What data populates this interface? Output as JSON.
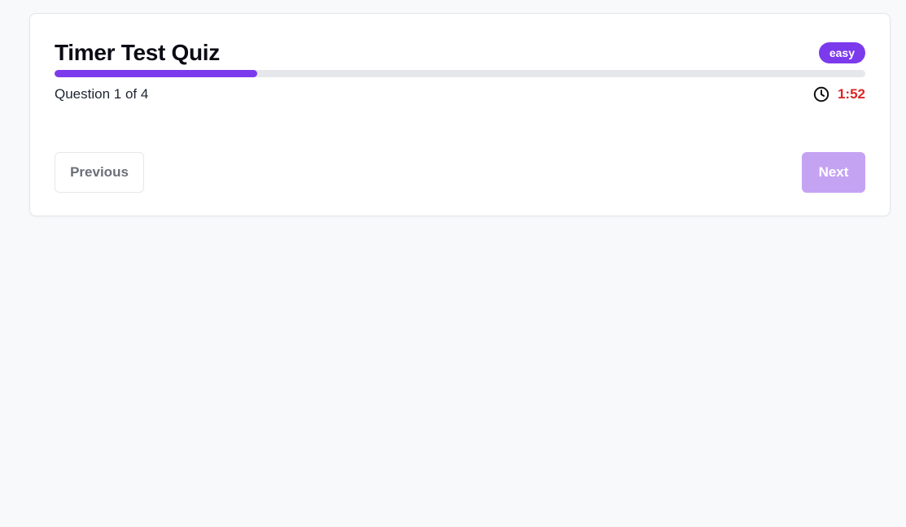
{
  "quiz": {
    "title": "Timer Test Quiz",
    "difficulty": "easy",
    "question_counter": "Question 1 of 4",
    "progress_fraction": 0.25,
    "timer_icon": "clock-icon",
    "timer_value": "1:52"
  },
  "navigation": {
    "previous_label": "Previous",
    "next_label": "Next"
  },
  "colors": {
    "accent": "#7c3aed",
    "next_disabled": "#c4a3f3",
    "timer_warning": "#dc2626",
    "track": "#e5e7eb"
  }
}
